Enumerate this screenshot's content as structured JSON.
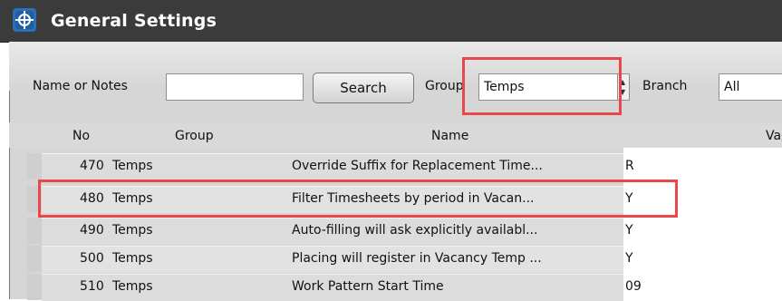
{
  "window": {
    "title": "General Settings",
    "app_icon": "app-logo-icon"
  },
  "filters": {
    "name_label": "Name or Notes",
    "name_value": "",
    "search_label": "Search",
    "group_label": "Group",
    "group_value": "Temps",
    "branch_label": "Branch",
    "branch_value": "All"
  },
  "grid": {
    "headers": {
      "no": "No",
      "group": "Group",
      "name": "Name",
      "value": "Va"
    },
    "rows": [
      {
        "no": "470",
        "group": "Temps",
        "name": "Override Suffix for Replacement Time...",
        "value": "R"
      },
      {
        "no": "480",
        "group": "Temps",
        "name": "Filter Timesheets by period in Vacan...",
        "value": "Y"
      },
      {
        "no": "490",
        "group": "Temps",
        "name": "Auto-filling will ask explicitly availabl...",
        "value": "Y"
      },
      {
        "no": "500",
        "group": "Temps",
        "name": "Placing will register in Vacancy Temp ...",
        "value": "Y"
      },
      {
        "no": "510",
        "group": "Temps",
        "name": "Work Pattern Start Time",
        "value": "09"
      }
    ]
  },
  "annotations": {
    "highlight_color": "#e8484c"
  }
}
